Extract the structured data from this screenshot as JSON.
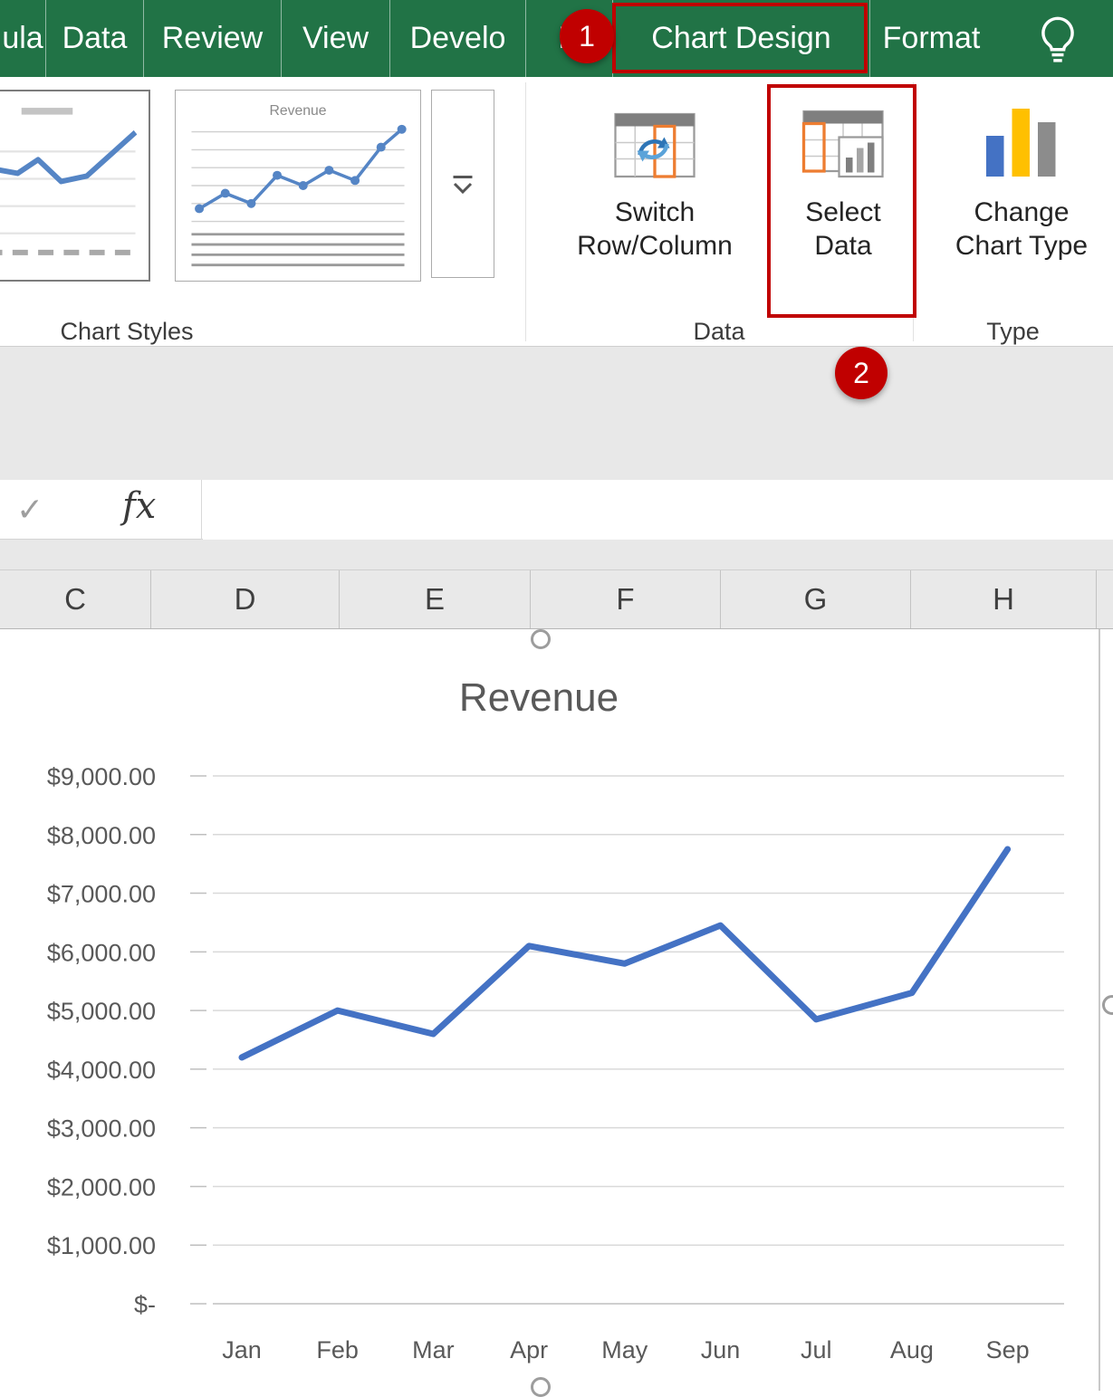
{
  "ribbon": {
    "tabs": [
      {
        "label": "ula"
      },
      {
        "label": "Data"
      },
      {
        "label": "Review"
      },
      {
        "label": "View"
      },
      {
        "label": "Develo"
      },
      {
        "label": "H"
      },
      {
        "label": "Chart Design",
        "active": true
      },
      {
        "label": "Format"
      }
    ],
    "chart_styles": {
      "group_label": "Chart Styles",
      "style2_title": "Revenue"
    },
    "data_group": {
      "label": "Data",
      "switch_row_column": "Switch Row/Column",
      "select_data": "Select Data"
    },
    "type_group": {
      "label": "Type",
      "change_chart_type": "Change Chart Type"
    },
    "callouts": {
      "step1": "1",
      "step2": "2"
    }
  },
  "icons": {
    "checkmark": "✓"
  },
  "formula_bar": {
    "fx_label": "fx",
    "value": ""
  },
  "sheet": {
    "columns": [
      "C",
      "D",
      "E",
      "F",
      "G",
      "H"
    ]
  },
  "chart_data": {
    "type": "line",
    "title": "Revenue",
    "categories": [
      "Jan",
      "Feb",
      "Mar",
      "Apr",
      "May",
      "Jun",
      "Jul",
      "Aug",
      "Sep"
    ],
    "series": [
      {
        "name": "Revenue",
        "values": [
          4200,
          5000,
          4600,
          6100,
          5800,
          6450,
          4850,
          5300,
          7750
        ]
      }
    ],
    "ylim": [
      0,
      9000
    ],
    "ytick_step": 1000,
    "ytick_labels": [
      "$-",
      "$1,000.00",
      "$2,000.00",
      "$3,000.00",
      "$4,000.00",
      "$5,000.00",
      "$6,000.00",
      "$7,000.00",
      "$8,000.00",
      "$9,000.00"
    ],
    "xlabel": "",
    "ylabel": "",
    "grid": true,
    "legend": false,
    "line_color": "#4472c4",
    "grid_color": "#d9d9d9",
    "axis_color": "#bfbfbf",
    "label_color": "#595959",
    "title_color": "#595959"
  },
  "colors": {
    "excel_green": "#217346",
    "annotation_red": "#c00000",
    "ribbon_bg": "#ffffff",
    "band_gray": "#e8e8e8"
  }
}
